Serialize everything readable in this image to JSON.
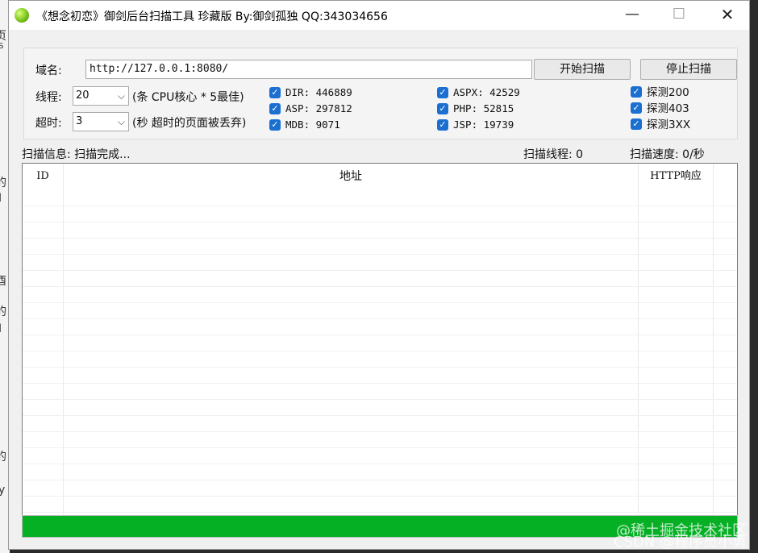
{
  "window": {
    "title": "《想念初恋》御剑后台扫描工具 珍藏版 By:御剑孤独 QQ:343034656",
    "minimize": "—",
    "maximize": "☐",
    "close": "✕"
  },
  "background": {
    "chars": [
      "页",
      "YS",
      "的",
      "I",
      "酉",
      "的",
      "I",
      "的",
      "y"
    ]
  },
  "form": {
    "domain_label": "域名:",
    "domain_value": "http://127.0.0.1:8080/",
    "start_button": "开始扫描",
    "stop_button": "停止扫描",
    "threads_label": "线程:",
    "threads_value": "20",
    "threads_hint": "(条 CPU核心 * 5最佳)",
    "timeout_label": "超时:",
    "timeout_value": "3",
    "timeout_hint": "(秒 超时的页面被丢弃)"
  },
  "checkboxes": {
    "dir": "DIR: 446889",
    "asp": "ASP: 297812",
    "mdb": "MDB: 9071",
    "aspx": "ASPX: 42529",
    "php": "PHP: 52815",
    "jsp": "JSP: 19739",
    "probe200": "探测200",
    "probe403": "探测403",
    "probe3xx": "探测3XX"
  },
  "status": {
    "info": "扫描信息: 扫描完成...",
    "threads": "扫描线程: 0",
    "speed": "扫描速度: 0/秒"
  },
  "table": {
    "columns": [
      "ID",
      "地址",
      "HTTP响应"
    ],
    "rows": []
  },
  "progress": {
    "value": 1.0
  },
  "colors": {
    "progress": "#06b025",
    "checkbox": "#1a6fd0"
  },
  "watermark": {
    "line1": "@稀土掘金技术社区",
    "line2": "CSDN @程序员小勇"
  }
}
